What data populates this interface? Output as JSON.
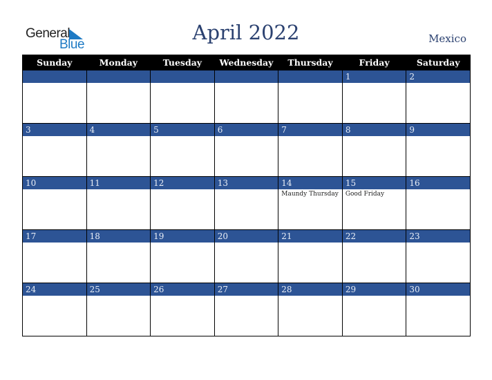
{
  "logo": {
    "line1": "General",
    "line2": "Blue"
  },
  "header": {
    "title": "April 2022",
    "country": "Mexico"
  },
  "colors": {
    "band": "#2d5495",
    "header_bg": "#000000",
    "title": "#2b4170",
    "logo_blue": "#1e7ac4"
  },
  "weekdays": [
    "Sunday",
    "Monday",
    "Tuesday",
    "Wednesday",
    "Thursday",
    "Friday",
    "Saturday"
  ],
  "weeks": [
    [
      {
        "day": "",
        "holiday": ""
      },
      {
        "day": "",
        "holiday": ""
      },
      {
        "day": "",
        "holiday": ""
      },
      {
        "day": "",
        "holiday": ""
      },
      {
        "day": "",
        "holiday": ""
      },
      {
        "day": "1",
        "holiday": ""
      },
      {
        "day": "2",
        "holiday": ""
      }
    ],
    [
      {
        "day": "3",
        "holiday": ""
      },
      {
        "day": "4",
        "holiday": ""
      },
      {
        "day": "5",
        "holiday": ""
      },
      {
        "day": "6",
        "holiday": ""
      },
      {
        "day": "7",
        "holiday": ""
      },
      {
        "day": "8",
        "holiday": ""
      },
      {
        "day": "9",
        "holiday": ""
      }
    ],
    [
      {
        "day": "10",
        "holiday": ""
      },
      {
        "day": "11",
        "holiday": ""
      },
      {
        "day": "12",
        "holiday": ""
      },
      {
        "day": "13",
        "holiday": ""
      },
      {
        "day": "14",
        "holiday": "Maundy Thursday"
      },
      {
        "day": "15",
        "holiday": "Good Friday"
      },
      {
        "day": "16",
        "holiday": ""
      }
    ],
    [
      {
        "day": "17",
        "holiday": ""
      },
      {
        "day": "18",
        "holiday": ""
      },
      {
        "day": "19",
        "holiday": ""
      },
      {
        "day": "20",
        "holiday": ""
      },
      {
        "day": "21",
        "holiday": ""
      },
      {
        "day": "22",
        "holiday": ""
      },
      {
        "day": "23",
        "holiday": ""
      }
    ],
    [
      {
        "day": "24",
        "holiday": ""
      },
      {
        "day": "25",
        "holiday": ""
      },
      {
        "day": "26",
        "holiday": ""
      },
      {
        "day": "27",
        "holiday": ""
      },
      {
        "day": "28",
        "holiday": ""
      },
      {
        "day": "29",
        "holiday": ""
      },
      {
        "day": "30",
        "holiday": ""
      }
    ]
  ]
}
